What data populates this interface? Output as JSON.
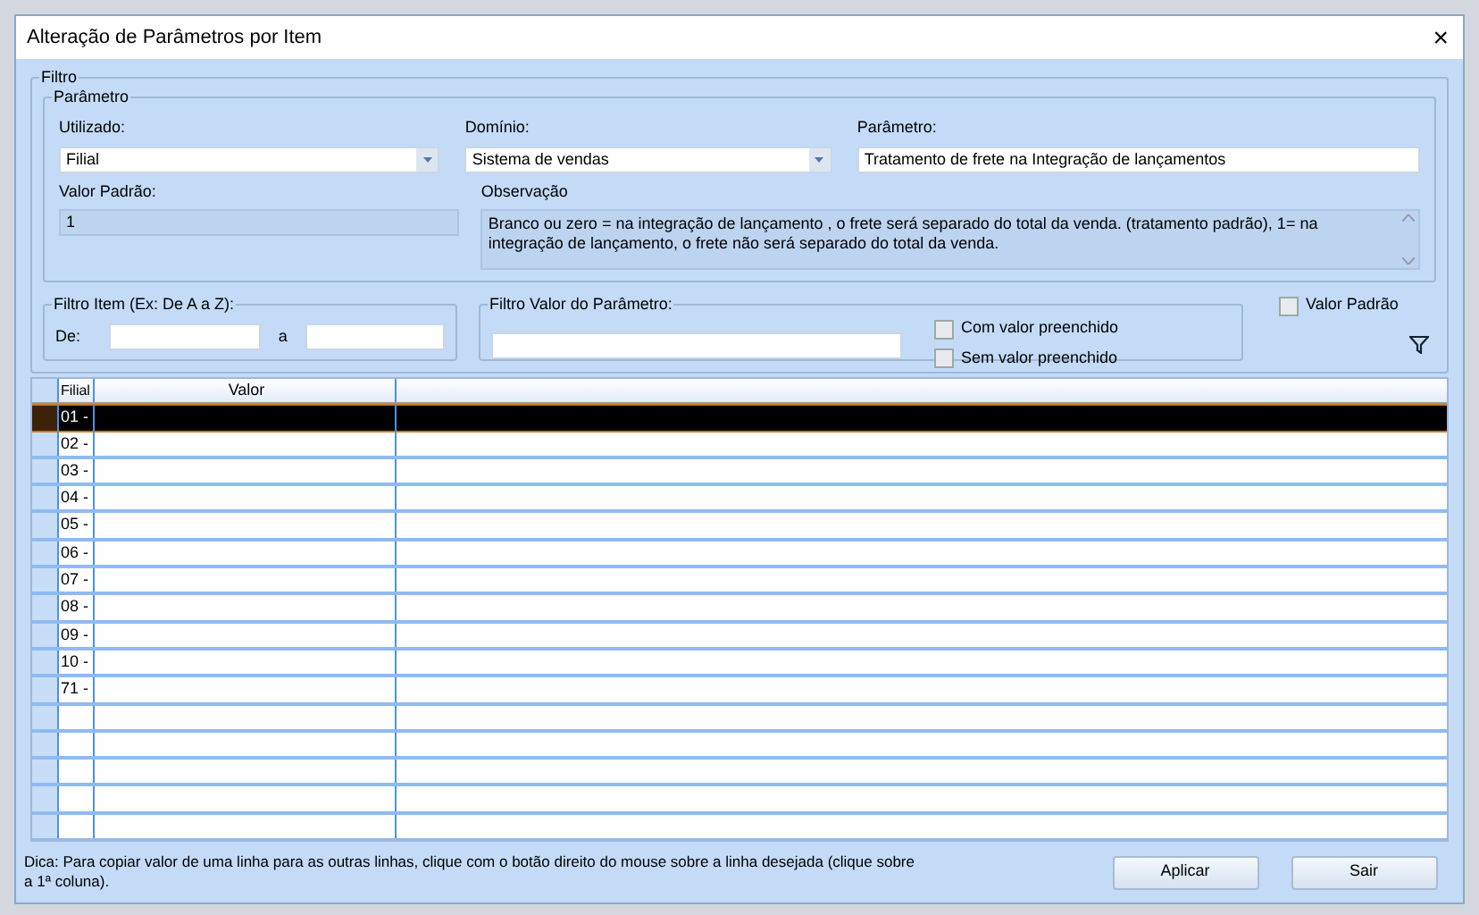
{
  "window": {
    "title": "Alteração de Parâmetros por Item",
    "close": "×"
  },
  "filtro": {
    "title": "Filtro",
    "parametro": {
      "title": "Parâmetro",
      "utilizado": {
        "label": "Utilizado:",
        "value": "Filial"
      },
      "dominio": {
        "label": "Domínio:",
        "value": "Sistema de vendas"
      },
      "parametro": {
        "label": "Parâmetro:",
        "value": "Tratamento de frete na Integração de lançamentos"
      },
      "valor_padrao": {
        "label": "Valor Padrão:",
        "value": "1"
      },
      "observacao": {
        "label": "Observação",
        "value": "Branco ou zero = na integração de lançamento , o frete será separado do total da venda. (tratamento padrão), 1= na integração de lançamento, o frete não será separado do total da venda."
      }
    },
    "filtro_item": {
      "title": "Filtro Item (Ex: De A a Z):",
      "de_label": "De:",
      "a_label": "a"
    },
    "filtro_valor": {
      "title": "Filtro Valor do Parâmetro:",
      "options": [
        {
          "label": "Com valor preenchido",
          "checked": false
        },
        {
          "label": "Sem valor preenchido",
          "checked": false
        }
      ]
    },
    "valor_padrao_check": {
      "label": "Valor Padrão",
      "checked": false
    }
  },
  "table": {
    "columns": [
      "Filial",
      "Valor"
    ],
    "rows": [
      {
        "filial": "01 -",
        "selected": true
      },
      {
        "filial": "02 -",
        "selected": false
      },
      {
        "filial": "03 -",
        "selected": false
      },
      {
        "filial": "04 -",
        "selected": false
      },
      {
        "filial": "05 -",
        "selected": false
      },
      {
        "filial": "06 -",
        "selected": false
      },
      {
        "filial": "07 -",
        "selected": false
      },
      {
        "filial": "08 -",
        "selected": false
      },
      {
        "filial": "09 -",
        "selected": false
      },
      {
        "filial": "10 -",
        "selected": false
      },
      {
        "filial": "71 -",
        "selected": false
      }
    ]
  },
  "hint": "Dica: Para copiar valor de uma linha para as outras linhas, clique com o botão direito do mouse sobre a linha desejada (clique sobre a 1ª coluna).",
  "buttons": [
    "Aplicar",
    "Sair"
  ]
}
